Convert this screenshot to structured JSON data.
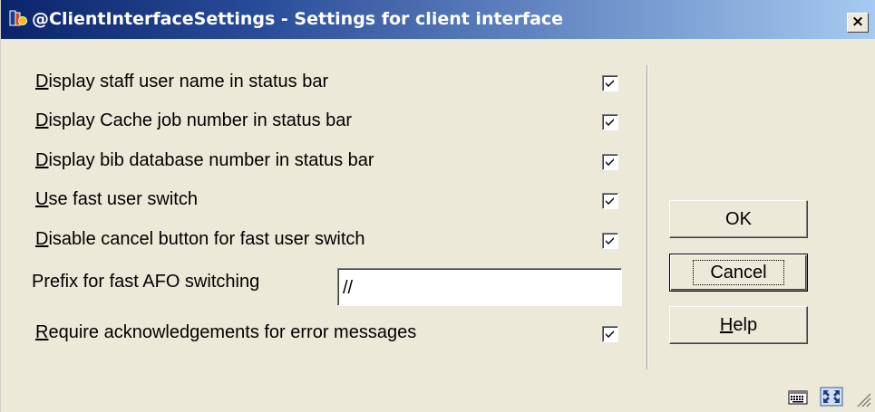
{
  "window": {
    "title": "@ClientInterfaceSettings - Settings for client interface",
    "close_label": "×"
  },
  "options": [
    {
      "label_first": "D",
      "label_rest": "isplay staff user name in status bar",
      "checked": true
    },
    {
      "label_first": "D",
      "label_rest": "isplay Cache job number in status bar",
      "checked": true
    },
    {
      "label_first": "D",
      "label_rest": "isplay bib database number in status bar",
      "checked": true
    },
    {
      "label_first": "U",
      "label_rest": "se fast user switch",
      "checked": true
    },
    {
      "label_first": "D",
      "label_rest": "isable cancel button for fast user switch",
      "checked": true
    }
  ],
  "prefix": {
    "label": "Prefix for fast AFO switching",
    "value": "//"
  },
  "ack": {
    "label_first": "R",
    "label_rest": "equire acknowledgements for error messages",
    "checked": true
  },
  "buttons": {
    "ok": "OK",
    "cancel": "Cancel",
    "help_first": "H",
    "help_rest": "elp"
  },
  "colors": {
    "title_start": "#0a246a",
    "title_end": "#a6caf0",
    "dialog_bg": "#ece9d8"
  }
}
